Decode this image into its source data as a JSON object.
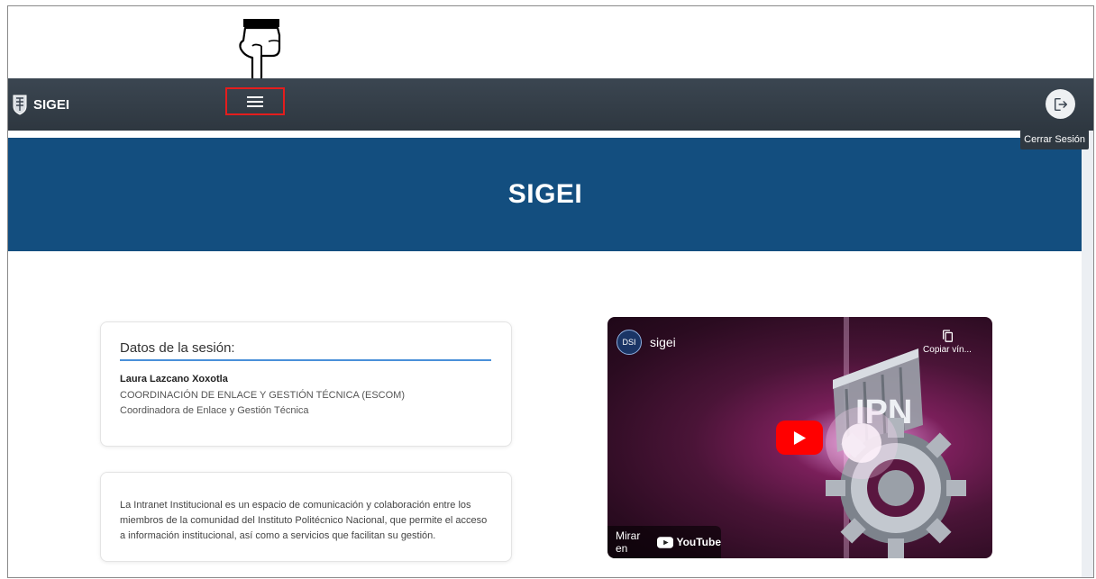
{
  "app": {
    "brand": "SIGEI"
  },
  "navbar": {
    "menu_icon": "hamburger-menu-icon",
    "logout_icon": "logout-icon",
    "logout_tooltip": "Cerrar Sesión"
  },
  "banner": {
    "title": "SIGEI"
  },
  "session": {
    "title": "Datos de la sesión:",
    "user_name": "Laura Lazcano Xoxotla",
    "department": "COORDINACIÓN DE ENLACE Y GESTIÓN TÉCNICA (ESCOM)",
    "position": "Coordinadora de Enlace y Gestión Técnica"
  },
  "info": {
    "text": "La Intranet Institucional es un espacio de comunicación y colaboración entre los miembros de la comunidad del Instituto Politécnico Nacional, que permite el acceso a información institucional, así como a servicios que facilitan su gestión."
  },
  "video": {
    "channel_avatar": "DSI",
    "channel_name": "sigei",
    "copy_label": "Copiar vín...",
    "watch_on": "Mirar en",
    "youtube": "YouTube",
    "logo_text": "IPN"
  },
  "colors": {
    "navbar": "#343e48",
    "banner": "#134e7f",
    "accent": "#4a90d9",
    "highlight": "#e41d1d",
    "play": "#ff0000"
  }
}
